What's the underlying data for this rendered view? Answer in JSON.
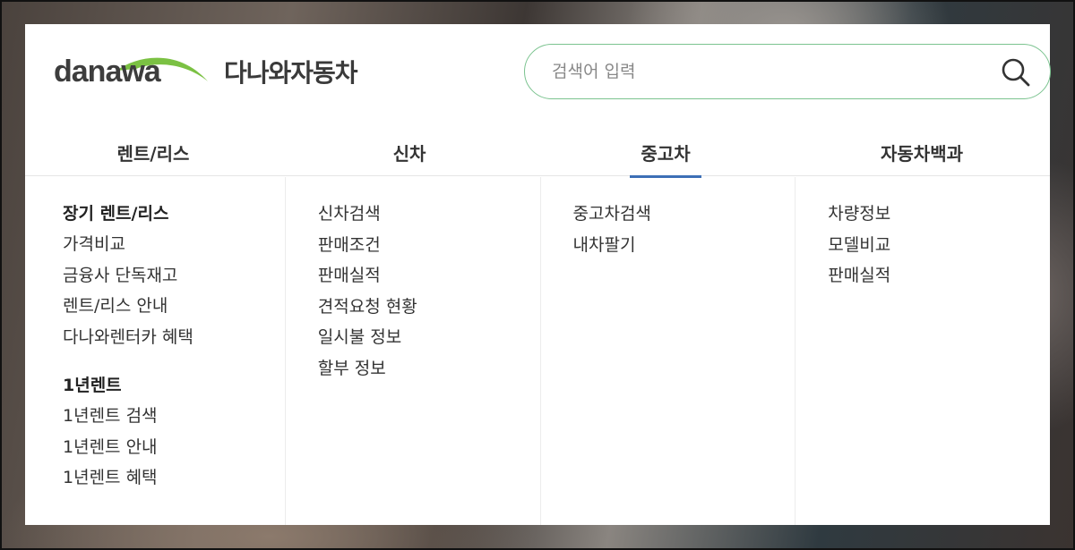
{
  "header": {
    "logo_text": "danawa",
    "service_name": "다나와자동차",
    "brand_color": "#7bc143"
  },
  "search": {
    "placeholder": "검색어 입력",
    "value": "",
    "icon": "search-icon",
    "border_color": "#7bc38f"
  },
  "tabs": [
    {
      "label": "렌트/리스",
      "active": false
    },
    {
      "label": "신차",
      "active": false
    },
    {
      "label": "중고차",
      "active": true
    },
    {
      "label": "자동차백과",
      "active": false
    }
  ],
  "accent_color": "#3d6fb6",
  "columns": {
    "rent": {
      "group1_title": "장기 렌트/리스",
      "group1_links": [
        "가격비교",
        "금융사 단독재고",
        "렌트/리스 안내",
        "다나와렌터카 혜택"
      ],
      "group2_title": "1년렌트",
      "group2_links": [
        "1년렌트 검색",
        "1년렌트 안내",
        "1년렌트 혜택"
      ]
    },
    "new_car": {
      "links": [
        "신차검색",
        "판매조건",
        "판매실적",
        "견적요청 현황",
        "일시불 정보",
        "할부 정보"
      ]
    },
    "used_car": {
      "links": [
        "중고차검색",
        "내차팔기"
      ]
    },
    "encyclopedia": {
      "links": [
        "차량정보",
        "모델비교",
        "판매실적"
      ]
    }
  }
}
